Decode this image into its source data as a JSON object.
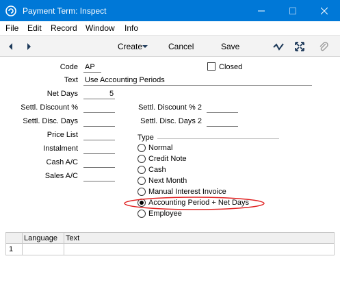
{
  "window": {
    "title": "Payment Term: Inspect"
  },
  "menu": [
    "File",
    "Edit",
    "Record",
    "Window",
    "Info"
  ],
  "toolbar": {
    "create_label": "Create",
    "cancel_label": "Cancel",
    "save_label": "Save"
  },
  "form": {
    "code_label": "Code",
    "code_value": "AP",
    "closed_label": "Closed",
    "closed_checked": false,
    "text_label": "Text",
    "text_value": "Use Accounting Periods",
    "net_days_label": "Net Days",
    "net_days_value": "5",
    "settl_discount_label": "Settl. Discount %",
    "settl_discount_value": "",
    "settl_disc_days_label": "Settl. Disc. Days",
    "settl_disc_days_value": "",
    "price_list_label": "Price List",
    "price_list_value": "",
    "instalment_label": "Instalment",
    "instalment_value": "",
    "cash_ac_label": "Cash A/C",
    "cash_ac_value": "",
    "sales_ac_label": "Sales A/C",
    "sales_ac_value": "",
    "settl_discount2_label": "Settl. Discount % 2",
    "settl_discount2_value": "",
    "settl_disc_days2_label": "Settl. Disc. Days 2",
    "settl_disc_days2_value": "",
    "type_label": "Type",
    "type_options": [
      "Normal",
      "Credit Note",
      "Cash",
      "Next Month",
      "Manual Interest Invoice",
      "Accounting Period + Net Days",
      "Employee"
    ],
    "type_selected": "Accounting Period + Net Days"
  },
  "grid": {
    "columns": [
      "Language",
      "Text"
    ],
    "rows": [
      {
        "num": "1",
        "language": "",
        "text": ""
      }
    ]
  },
  "colors": {
    "titlebar": "#0078d7",
    "highlight_ellipse": "#e02020"
  }
}
